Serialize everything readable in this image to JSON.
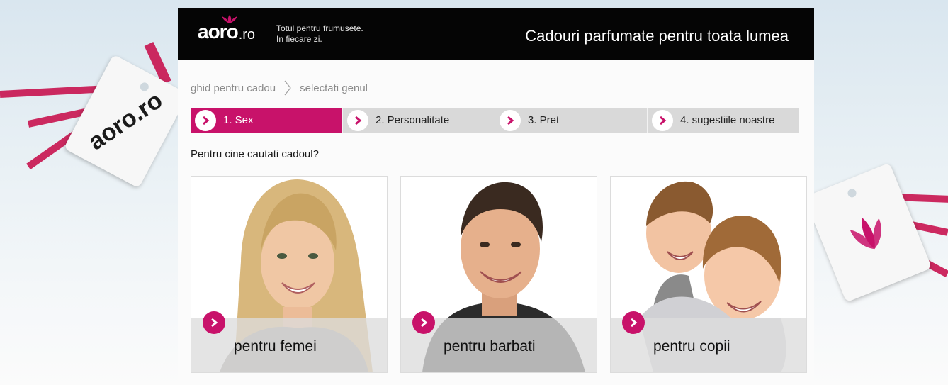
{
  "header": {
    "logo_name": "aoro",
    "logo_suffix": ".ro",
    "tagline_line1": "Totul pentru frumusete.",
    "tagline_line2": "In fiecare zi.",
    "headline": "Cadouri parfumate pentru toata lumea"
  },
  "decor": {
    "tag_left_text": "aoro.ro"
  },
  "breadcrumb": {
    "items": [
      "ghid pentru cadou",
      "selectati genul"
    ]
  },
  "steps": [
    {
      "label": "1. Sex",
      "active": true
    },
    {
      "label": "2. Personalitate",
      "active": false
    },
    {
      "label": "3. Pret",
      "active": false
    },
    {
      "label": "4. sugestiile noastre",
      "active": false
    }
  ],
  "question": "Pentru cine cautati cadoul?",
  "cards": [
    {
      "label": "pentru femei",
      "icon": "woman-photo"
    },
    {
      "label": "pentru barbati",
      "icon": "man-photo"
    },
    {
      "label": "pentru copii",
      "icon": "children-photo"
    }
  ],
  "colors": {
    "accent": "#c8126a",
    "header_bg": "#050505",
    "step_bg": "#d9d9d9"
  }
}
